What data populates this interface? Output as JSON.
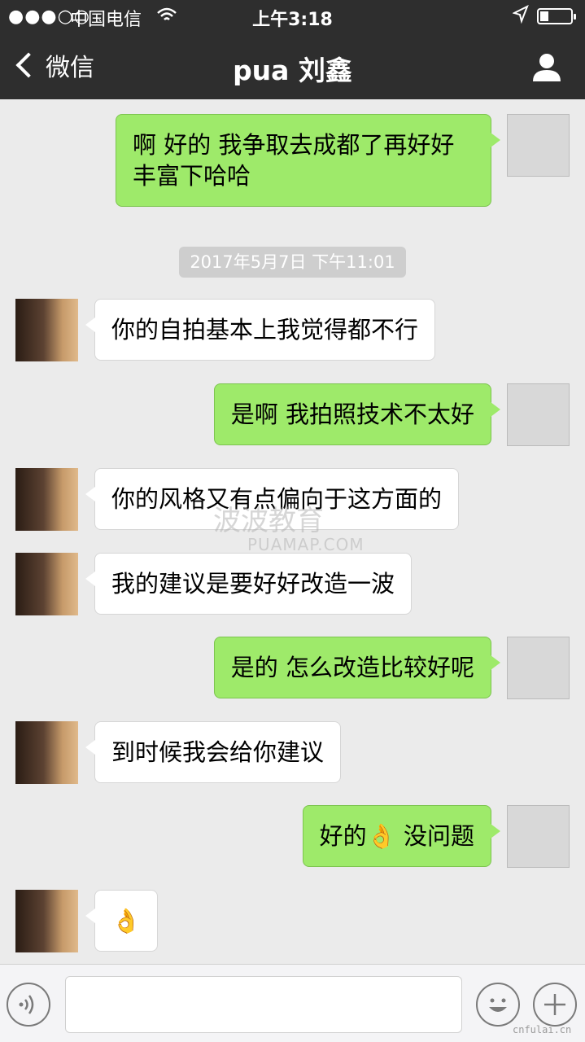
{
  "status_bar": {
    "signal": "●●●○○",
    "carrier": "中国电信",
    "time": "上午3:18"
  },
  "nav": {
    "back_label": "微信",
    "title": "pua 刘鑫",
    "icons": {
      "back": "chevron-left-icon",
      "profile": "person-icon"
    }
  },
  "messages": [
    {
      "from": "me",
      "text": "啊 好的 我争取去成都了再好好丰富下哈哈"
    },
    {
      "from": "other",
      "text": "你的自拍基本上我觉得都不行"
    },
    {
      "from": "me",
      "text": "是啊 我拍照技术不太好"
    },
    {
      "from": "other",
      "text": "你的风格又有点偏向于这方面的"
    },
    {
      "from": "other",
      "text": "我的建议是要好好改造一波"
    },
    {
      "from": "me",
      "text": "是的 怎么改造比较好呢"
    },
    {
      "from": "other",
      "text": "到时候我会给你建议"
    },
    {
      "from": "me",
      "text": "好的👌 没问题"
    },
    {
      "from": "other",
      "text": "👌"
    }
  ],
  "timestamp": "2017年5月7日 下午11:01",
  "watermark": {
    "main": "波波教育",
    "sub": "PUAMAP.COM"
  },
  "corner_mark": "cnfulai.cn",
  "colors": {
    "header": "#2e2e2e",
    "me_bubble": "#9eea6a",
    "other_bubble": "#ffffff",
    "background": "#ebebeb"
  },
  "input_bar": {
    "icons": [
      "voice-icon",
      "emoji-icon",
      "plus-icon"
    ]
  }
}
